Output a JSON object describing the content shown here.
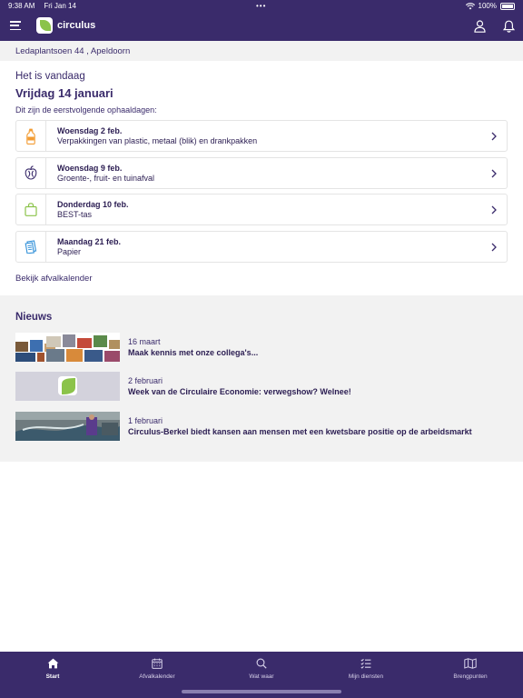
{
  "status_bar": {
    "time": "9:38 AM",
    "date": "Fri Jan 14",
    "dots": "•••",
    "battery": "100%"
  },
  "navbar": {
    "logo_text": "circulus",
    "icons": [
      "menu-icon",
      "user-icon",
      "bell-icon"
    ]
  },
  "address": {
    "text": "Ledaplantsoen 44  , Apeldoorn"
  },
  "today": {
    "label": "Het is vandaag",
    "date": "Vrijdag 14 januari",
    "next_label": "Dit zijn de eerstvolgende ophaaldagen:"
  },
  "pickups": [
    {
      "date": "Woensdag 2 feb.",
      "type": "Verpakkingen van plastic, metaal (blik) en drankpakken",
      "icon": "bottle-icon",
      "color": "#f39c33"
    },
    {
      "date": "Woensdag 9 feb.",
      "type": "Groente-, fruit- en tuinafval",
      "icon": "apple-core-icon",
      "color": "#3a2b6b"
    },
    {
      "date": "Donderdag 10 feb.",
      "type": "BEST-tas",
      "icon": "bag-icon",
      "color": "#8bc34a"
    },
    {
      "date": "Maandag 21 feb.",
      "type": "Papier",
      "icon": "paper-icon",
      "color": "#2f8fd8"
    }
  ],
  "calendar_link": "Bekijk afvalkalender",
  "news": {
    "title": "Nieuws",
    "items": [
      {
        "date": "16 maart",
        "headline": "Maak kennis met onze collega's..."
      },
      {
        "date": "2 februari",
        "headline": "Week van de Circulaire Economie: verwegshow? Welnee!"
      },
      {
        "date": "1 februari",
        "headline": "Circulus-Berkel biedt kansen aan mensen met een kwetsbare positie op de arbeidsmarkt"
      }
    ]
  },
  "tabs": [
    {
      "label": "Start",
      "icon": "home-icon",
      "active": true
    },
    {
      "label": "Afvalkalender",
      "icon": "calendar-icon",
      "active": false
    },
    {
      "label": "Wat waar",
      "icon": "search-icon",
      "active": false
    },
    {
      "label": "Mijn diensten",
      "icon": "checklist-icon",
      "active": false
    },
    {
      "label": "Brengpunten",
      "icon": "map-icon",
      "active": false
    }
  ],
  "colors": {
    "brand": "#3a2b6b",
    "accent_green": "#8bc34a"
  }
}
